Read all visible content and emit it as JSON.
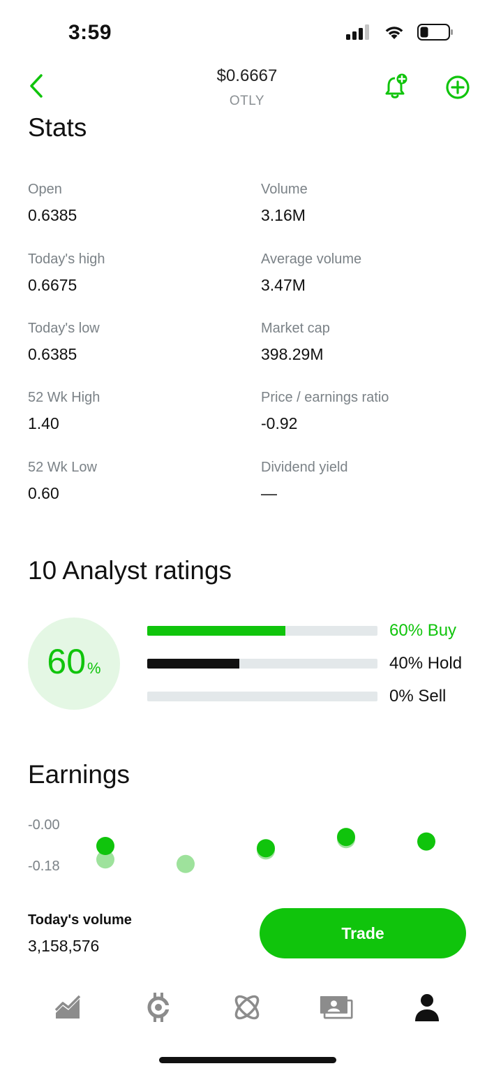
{
  "status_bar": {
    "time": "3:59"
  },
  "header": {
    "price": "$0.6667",
    "ticker": "OTLY"
  },
  "stats": {
    "title": "Stats",
    "items": [
      {
        "label": "Open",
        "value": "0.6385"
      },
      {
        "label": "Volume",
        "value": "3.16M"
      },
      {
        "label": "Today's high",
        "value": "0.6675"
      },
      {
        "label": "Average volume",
        "value": "3.47M"
      },
      {
        "label": "Today's low",
        "value": "0.6385"
      },
      {
        "label": "Market cap",
        "value": "398.29M"
      },
      {
        "label": "52 Wk High",
        "value": "1.40"
      },
      {
        "label": "Price / earnings ratio",
        "value": "-0.92"
      },
      {
        "label": "52 Wk Low",
        "value": "0.60"
      },
      {
        "label": "Dividend yield",
        "value": "—"
      }
    ]
  },
  "analyst": {
    "title": "10 Analyst ratings",
    "circle_value": "60",
    "circle_unit": "%",
    "bars": [
      {
        "label": "60% Buy",
        "fraction": 0.6,
        "color": "#10c40c",
        "label_color": "#10c40c"
      },
      {
        "label": "40% Hold",
        "fraction": 0.4,
        "color": "#111111",
        "label_color": "#111111"
      },
      {
        "label": "0% Sell",
        "fraction": 0.0,
        "color": "#111111",
        "label_color": "#111111"
      }
    ]
  },
  "earnings": {
    "title": "Earnings",
    "axis_top": "-0.00",
    "axis_bottom": "-0.18"
  },
  "chart_data": {
    "type": "scatter",
    "ylim": [
      -0.18,
      -0.0
    ],
    "series": [
      {
        "values": [
          -0.15,
          -0.17,
          -0.11,
          -0.06,
          null
        ],
        "color": "#9ee29c"
      },
      {
        "values": [
          -0.09,
          null,
          -0.1,
          -0.05,
          -0.07
        ],
        "color": "#10c40c"
      }
    ]
  },
  "footer": {
    "volume_label": "Today's volume",
    "volume_value": "3,158,576",
    "trade_label": "Trade"
  },
  "tabs": [
    {
      "icon": "chart-icon",
      "active": false
    },
    {
      "icon": "bitcoin-icon",
      "active": false
    },
    {
      "icon": "atom-icon",
      "active": false
    },
    {
      "icon": "money-icon",
      "active": false
    },
    {
      "icon": "profile-icon",
      "active": true
    }
  ],
  "colors": {
    "accent": "#10c40c",
    "accent_light": "#9ee29c",
    "muted": "#7b8287"
  }
}
